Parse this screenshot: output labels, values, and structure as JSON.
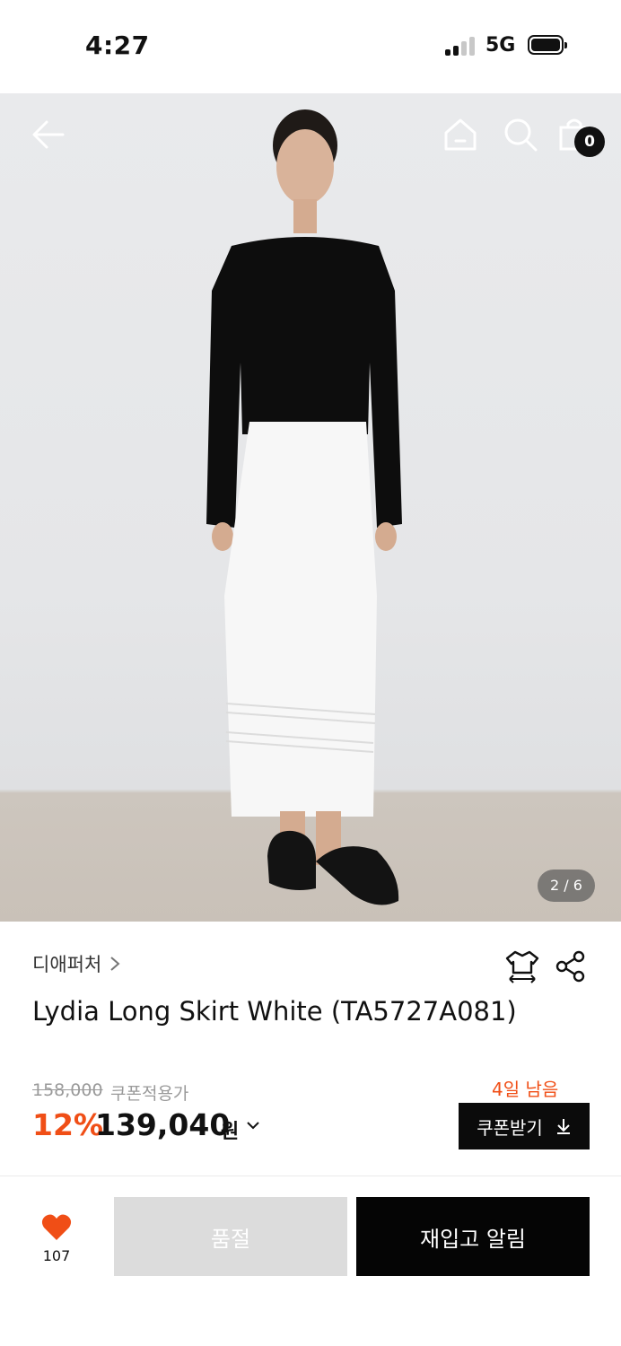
{
  "status_bar": {
    "time": "4:27",
    "network": "5G"
  },
  "header": {
    "cart_count": "0"
  },
  "gallery": {
    "pager": "2 / 6"
  },
  "product": {
    "brand": "디애퍼처",
    "title": "Lydia Long Skirt White (TA5727A081)",
    "original_price": "158,000",
    "coupon_label": "쿠폰적용가",
    "discount": "12%",
    "sale_price": "139,040",
    "currency": "원",
    "days_left": "4일 남음",
    "coupon_button": "쿠폰받기"
  },
  "bottom_bar": {
    "like_count": "107",
    "soldout_label": "품절",
    "restock_label": "재입고 알림"
  },
  "colors": {
    "accent": "#f04e16",
    "primary": "#111111",
    "disabled": "#dcdcdc"
  },
  "icons": [
    "back-arrow-icon",
    "home-icon",
    "search-icon",
    "shopping-bag-icon",
    "size-guide-icon",
    "share-icon",
    "heart-icon",
    "download-icon",
    "chevron-right-icon",
    "chevron-down-icon"
  ]
}
